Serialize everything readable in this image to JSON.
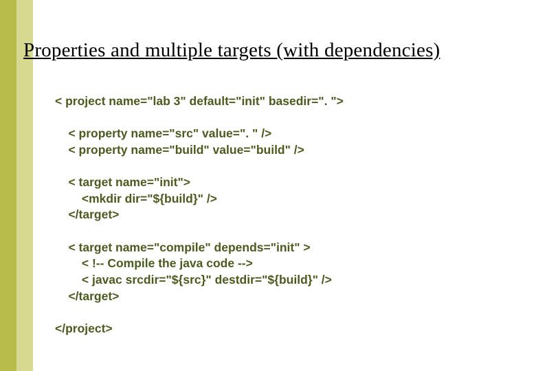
{
  "title": "Properties and multiple targets (with dependencies)",
  "code": {
    "l0": "< project name=\"lab 3\" default=\"init\" basedir=\". \">",
    "l1": "",
    "l2": "    < property name=\"src\" value=\". \" />",
    "l3": "    < property name=\"build\" value=\"build\" />",
    "l4": "",
    "l5": "    < target name=\"init\">",
    "l6": "        <mkdir dir=\"${build}\" />",
    "l7": "    </target>",
    "l8": "",
    "l9": "    < target name=\"compile\" depends=\"init\" >",
    "l10": "        < !-- Compile the java code -->",
    "l11": "        < javac srcdir=\"${src}\" destdir=\"${build}\" />",
    "l12": "    </target>",
    "l13": "",
    "l14": "</project>"
  }
}
